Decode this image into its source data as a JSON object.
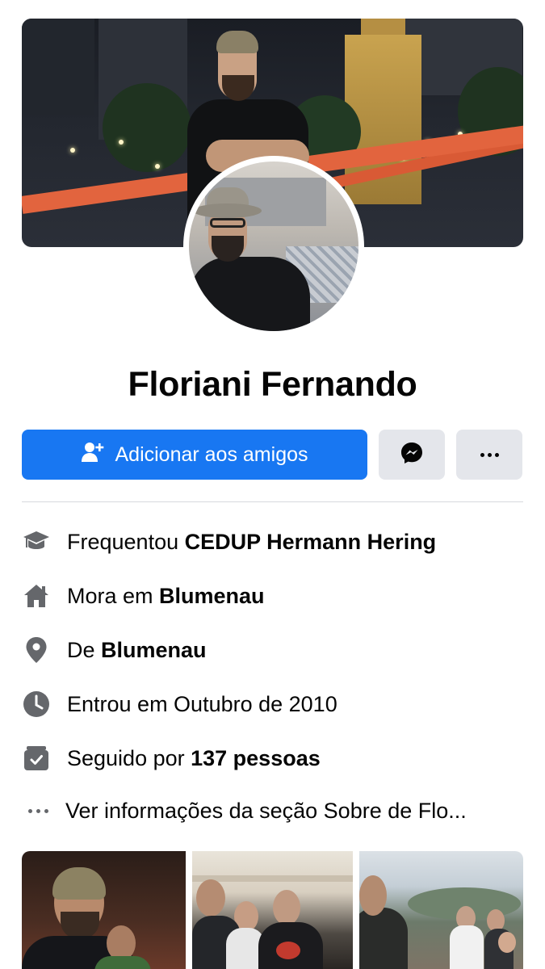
{
  "profile": {
    "name": "Floriani Fernando"
  },
  "actions": {
    "add_friend_label": "Adicionar aos amigos"
  },
  "info": [
    {
      "icon": "graduation-cap-icon",
      "prefix": "Frequentou ",
      "bold": "CEDUP Hermann Hering"
    },
    {
      "icon": "home-icon",
      "prefix": "Mora em ",
      "bold": "Blumenau"
    },
    {
      "icon": "location-pin-icon",
      "prefix": "De ",
      "bold": "Blumenau"
    },
    {
      "icon": "clock-icon",
      "prefix": "Entrou em Outubro de 2010",
      "bold": ""
    },
    {
      "icon": "followers-icon",
      "prefix": "Seguido por ",
      "bold": "137 pessoas"
    }
  ],
  "about_link": "Ver informações da seção Sobre de Flo...",
  "colors": {
    "primary": "#1877f2",
    "secondary_button": "#e4e6eb",
    "text": "#050505",
    "icon": "#65676b"
  }
}
